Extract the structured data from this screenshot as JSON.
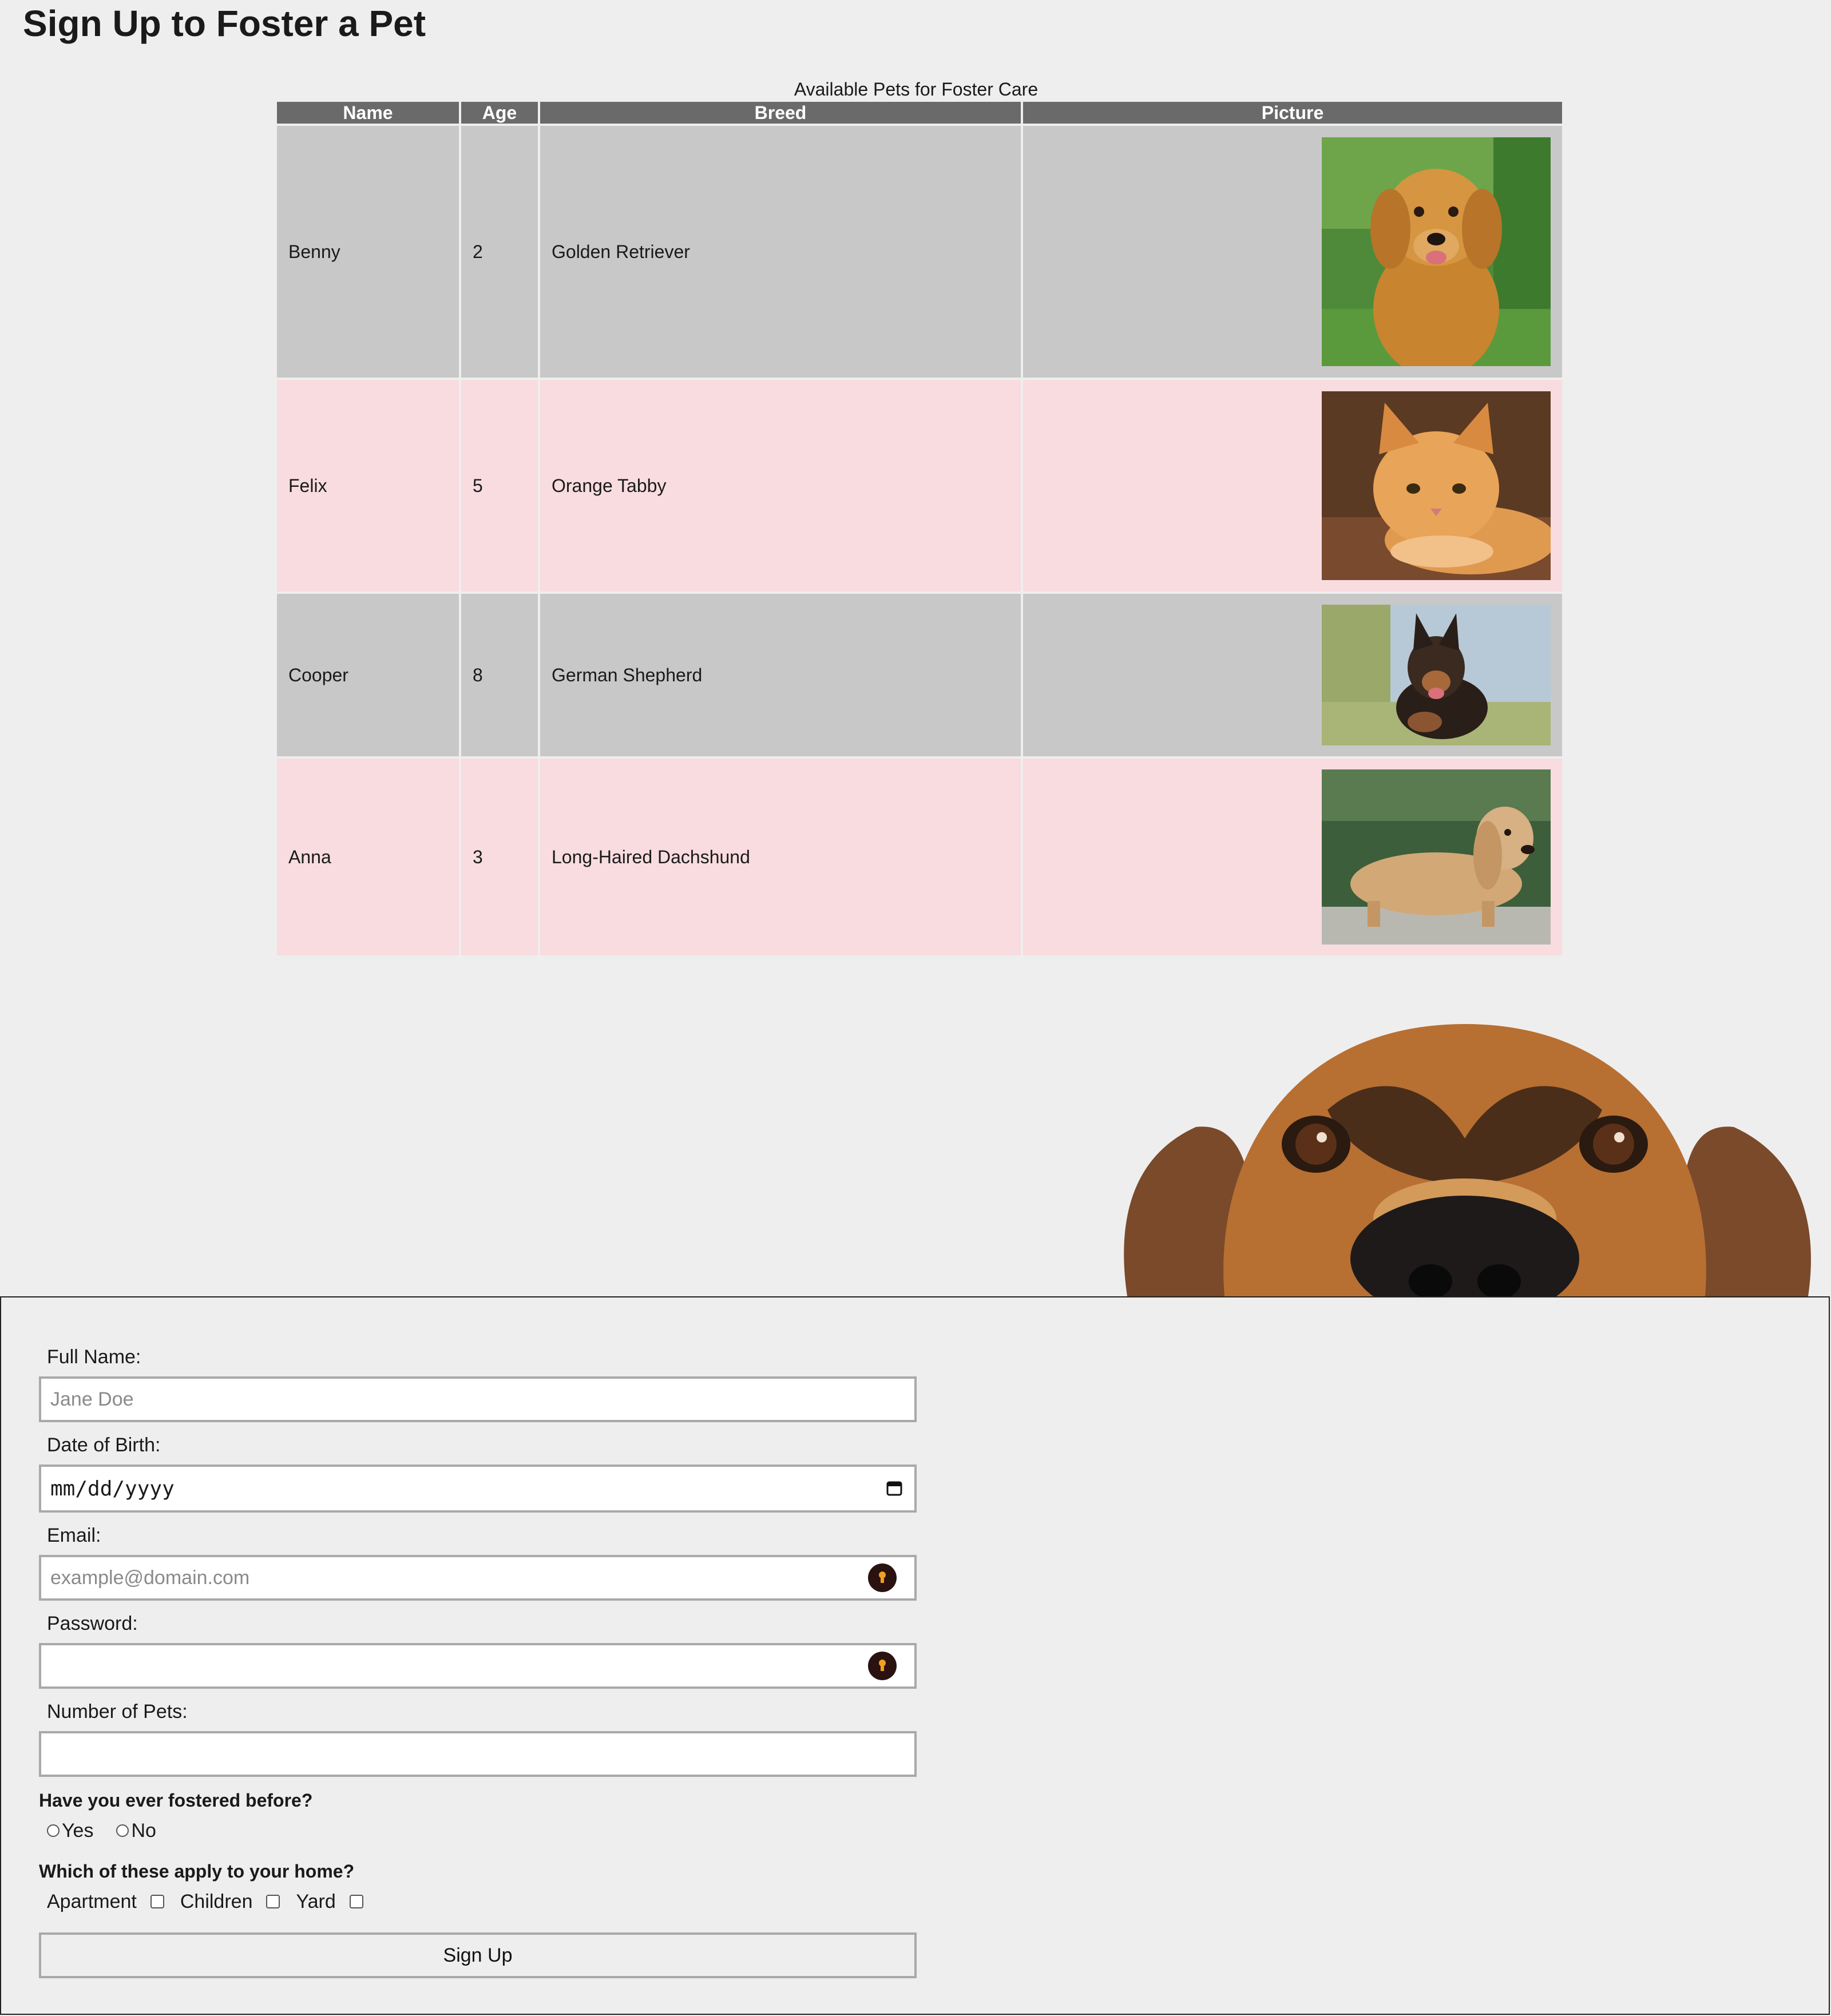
{
  "page": {
    "title": "Sign Up to Foster a Pet"
  },
  "table": {
    "caption": "Available Pets for Foster Care",
    "headers": {
      "name": "Name",
      "age": "Age",
      "breed": "Breed",
      "picture": "Picture"
    },
    "rows": [
      {
        "name": "Benny",
        "age": "2",
        "breed": "Golden Retriever",
        "photo": "golden-retriever-photo"
      },
      {
        "name": "Felix",
        "age": "5",
        "breed": "Orange Tabby",
        "photo": "orange-tabby-photo"
      },
      {
        "name": "Cooper",
        "age": "8",
        "breed": "German Shepherd",
        "photo": "german-shepherd-photo"
      },
      {
        "name": "Anna",
        "age": "3",
        "breed": "Long-Haired Dachshund",
        "photo": "dachshund-photo"
      }
    ]
  },
  "form": {
    "full_name_label": "Full Name:",
    "full_name_placeholder": "Jane Doe",
    "dob_label": "Date of Birth:",
    "dob_placeholder": "mm/dd/yyyy",
    "email_label": "Email:",
    "email_placeholder": "example@domain.com",
    "password_label": "Password:",
    "pets_label": "Number of Pets:",
    "fostered_question": "Have you ever fostered before?",
    "fostered_options": {
      "yes": "Yes",
      "no": "No"
    },
    "home_question": "Which of these apply to your home?",
    "home_options": {
      "apartment": "Apartment",
      "children": "Children",
      "yard": "Yard"
    },
    "submit_label": "Sign Up"
  },
  "colors": {
    "header_bg": "#6a6a6a",
    "row_gray": "#c8c8c8",
    "row_pink": "#f8dce0",
    "page_bg": "#eeeeee"
  },
  "icons": {
    "date": "calendar-icon",
    "autofill": "password-manager-key-icon"
  }
}
